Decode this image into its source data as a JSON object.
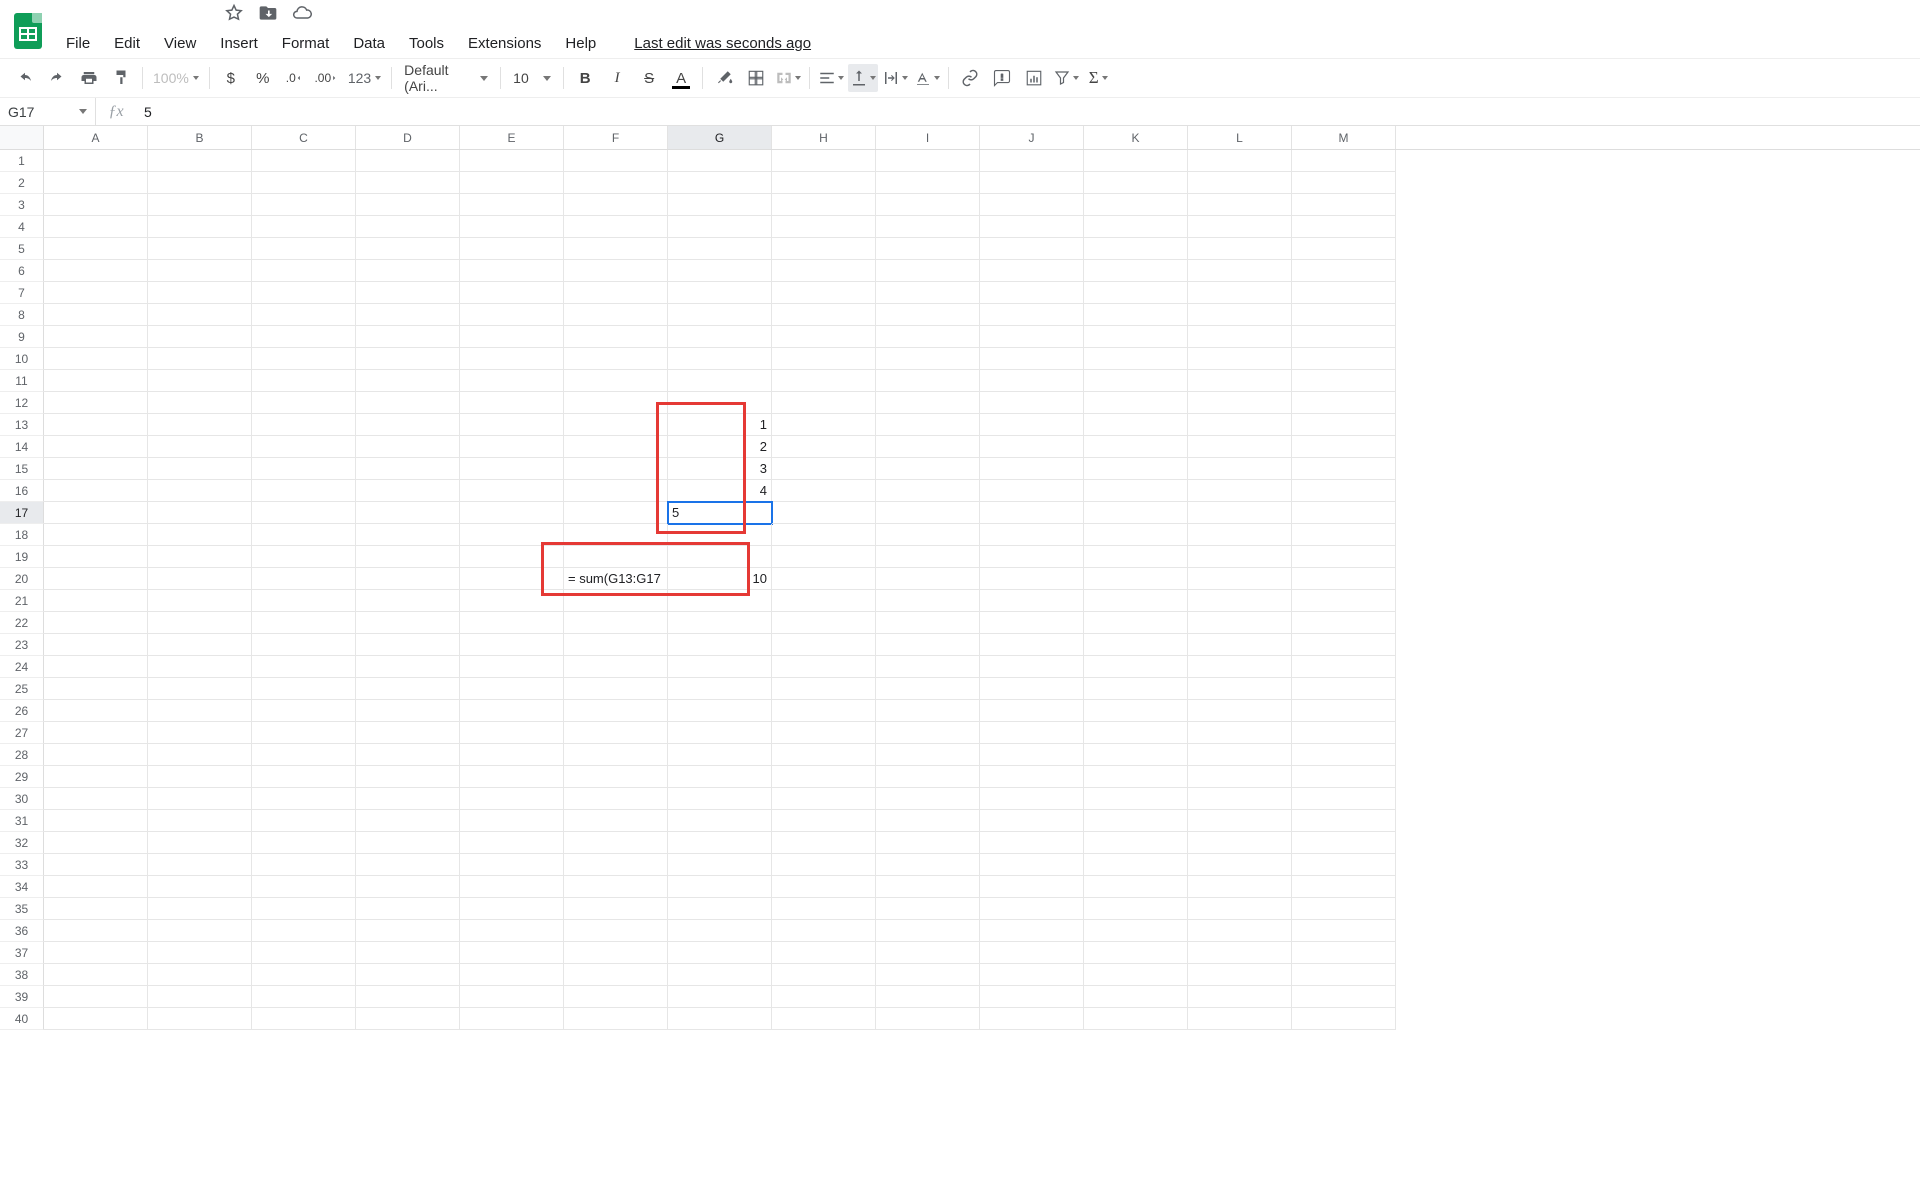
{
  "menubar": {
    "file": "File",
    "edit": "Edit",
    "view": "View",
    "insert": "Insert",
    "format": "Format",
    "data": "Data",
    "tools": "Tools",
    "extensions": "Extensions",
    "help": "Help",
    "last_edit": "Last edit was seconds ago"
  },
  "toolbar": {
    "zoom": "100%",
    "currency": "$",
    "percent": "%",
    "dec_dec": ".0",
    "inc_dec": ".00",
    "more_formats": "123",
    "font": "Default (Ari...",
    "font_size": "10"
  },
  "namebox": "G17",
  "fx_value": "5",
  "columns": [
    "A",
    "B",
    "C",
    "D",
    "E",
    "F",
    "G",
    "H",
    "I",
    "J",
    "K",
    "L",
    "M"
  ],
  "row_count": 40,
  "selected": {
    "row": 17,
    "col": "G"
  },
  "cells": {
    "G13": "1",
    "G14": "2",
    "G15": "3",
    "G16": "4",
    "G17": "5",
    "F20": "= sum(G13:G17",
    "G20": "10"
  }
}
